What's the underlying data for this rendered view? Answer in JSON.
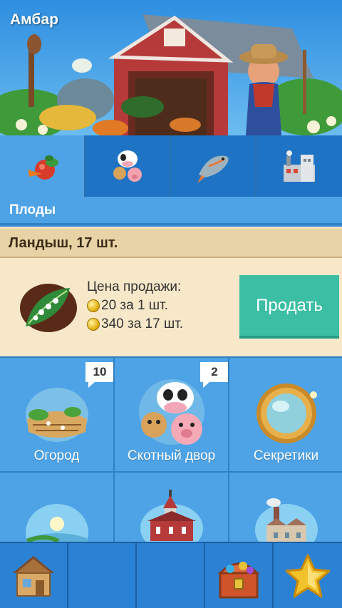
{
  "banner": {
    "title": "Амбар"
  },
  "tabs": [
    {
      "icon": "fruits-icon",
      "active": true
    },
    {
      "icon": "cow-pig-icon",
      "active": false
    },
    {
      "icon": "fish-icon",
      "active": false
    },
    {
      "icon": "factory-icon",
      "active": false
    }
  ],
  "section": {
    "title": "Плоды"
  },
  "item": {
    "title": "Ландыш, 17 шт.",
    "price_label": "Цена продажи:",
    "price_one": "20 за 1 шт.",
    "price_all": "340 за 17 шт.",
    "sell_label": "Продать"
  },
  "grid": [
    {
      "label": "Огород",
      "badge": "10",
      "icon": "garden-icon"
    },
    {
      "label": "Скотный двор",
      "badge": "2",
      "icon": "farmyard-icon"
    },
    {
      "label": "Секретики",
      "badge": "",
      "icon": "secrets-mirror-icon"
    },
    {
      "label": "",
      "badge": "",
      "icon": "lake-icon"
    },
    {
      "label": "",
      "badge": "",
      "icon": "church-icon"
    },
    {
      "label": "",
      "badge": "",
      "icon": "factory-town-icon"
    }
  ],
  "bottom_bar": [
    {
      "icon": "house-icon"
    },
    {
      "icon": ""
    },
    {
      "icon": ""
    },
    {
      "icon": "treasure-chest-icon"
    },
    {
      "icon": "star-icon"
    }
  ],
  "colors": {
    "primary_blue": "#4da3e6",
    "dark_blue": "#2f7fc4",
    "sell_button": "#3cbea4",
    "card_bg": "#f6e8c9"
  }
}
